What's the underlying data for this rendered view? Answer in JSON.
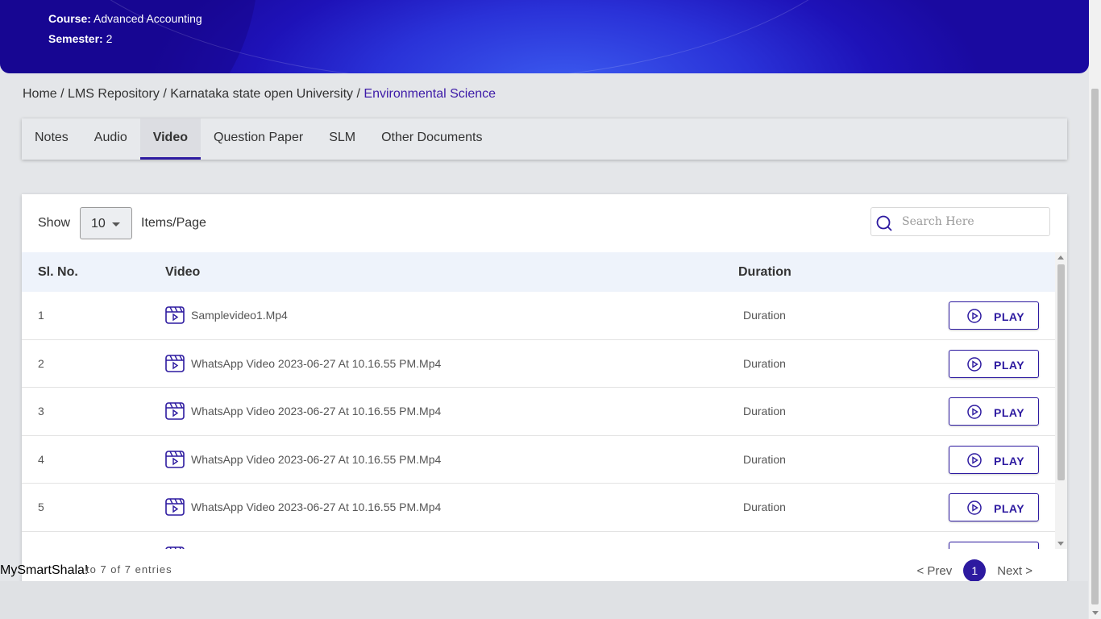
{
  "header": {
    "course_label": "Course:",
    "course_value": "Advanced Accounting",
    "semester_label": "Semester:",
    "semester_value": "2"
  },
  "breadcrumb": {
    "items": [
      "Home",
      "LMS Repository",
      "Karnataka state open University"
    ],
    "separator": "/",
    "active": "Environmental Science"
  },
  "tabs": [
    {
      "label": "Notes",
      "active": false
    },
    {
      "label": "Audio",
      "active": false
    },
    {
      "label": "Video",
      "active": true
    },
    {
      "label": "Question Paper",
      "active": false
    },
    {
      "label": "SLM",
      "active": false
    },
    {
      "label": "Other Documents",
      "active": false
    }
  ],
  "toolbar": {
    "show_label": "Show",
    "page_size": "10",
    "items_label": "Items/Page",
    "search_placeholder": "Search Here"
  },
  "table": {
    "headers": {
      "sl": "Sl. No.",
      "video": "Video",
      "duration": "Duration"
    },
    "rows": [
      {
        "sl": "1",
        "name": "Samplevideo1.Mp4",
        "duration": "Duration",
        "action": "PLAY"
      },
      {
        "sl": "2",
        "name": "WhatsApp Video 2023-06-27 At 10.16.55 PM.Mp4",
        "duration": "Duration",
        "action": "PLAY"
      },
      {
        "sl": "3",
        "name": "WhatsApp Video 2023-06-27 At 10.16.55 PM.Mp4",
        "duration": "Duration",
        "action": "PLAY"
      },
      {
        "sl": "4",
        "name": "WhatsApp Video 2023-06-27 At 10.16.55 PM.Mp4",
        "duration": "Duration",
        "action": "PLAY"
      },
      {
        "sl": "5",
        "name": "WhatsApp Video 2023-06-27 At 10.16.55 PM.Mp4",
        "duration": "Duration",
        "action": "PLAY"
      },
      {
        "sl": "",
        "name": "",
        "duration": "",
        "action": ""
      }
    ]
  },
  "footer": {
    "entries_text": "to 7  of 7 entries",
    "prev_label": "<  Prev",
    "current_page": "1",
    "next_label": "Next  >"
  },
  "brand": "MySmartShala!",
  "colors": {
    "accent": "#2d1aa0",
    "banner": "#2a32d8"
  }
}
